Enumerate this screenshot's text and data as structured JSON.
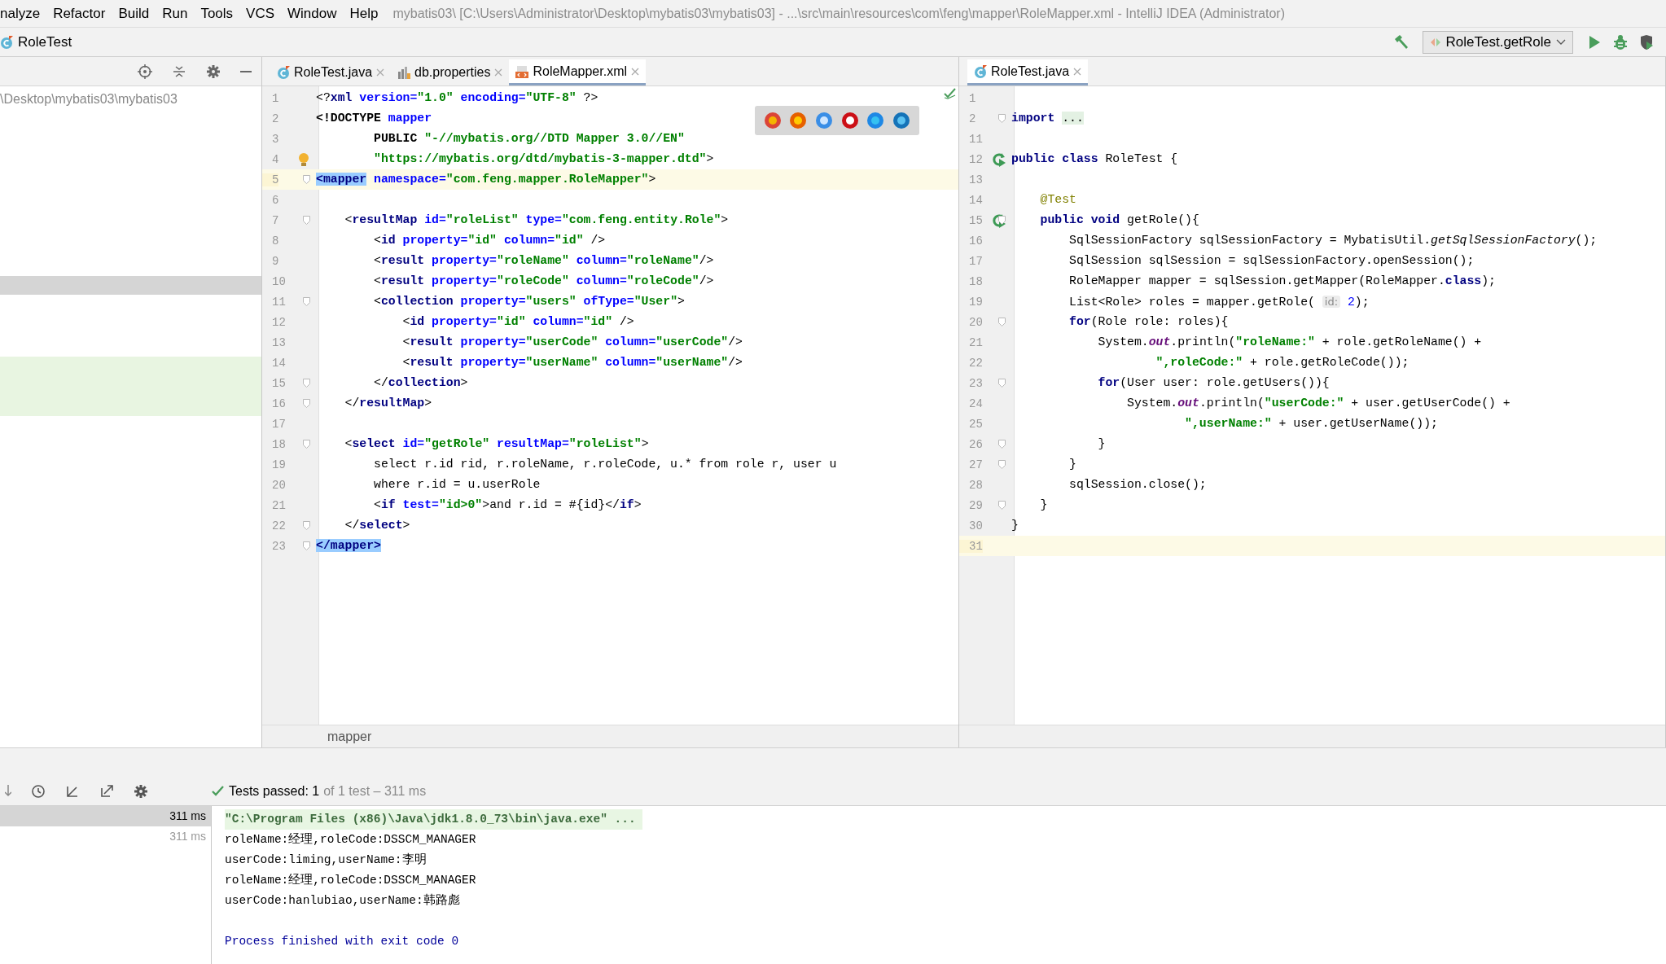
{
  "menu_bar": {
    "items": [
      "nalyze",
      "Refactor",
      "Build",
      "Run",
      "Tools",
      "VCS",
      "Window",
      "Help"
    ],
    "title": "mybatis03\\ [C:\\Users\\Administrator\\Desktop\\mybatis03\\mybatis03] - ...\\src\\main\\resources\\com\\feng\\mapper\\RoleMapper.xml - IntelliJ IDEA (Administrator)"
  },
  "nav_bar": {
    "breadcrumb": "RoleTest",
    "run_config": "RoleTest.getRole"
  },
  "project_panel": {
    "path": "\\Desktop\\mybatis03\\mybatis03",
    "tree_rows": [
      {
        "kind": "selected"
      },
      {
        "kind": "modified"
      }
    ]
  },
  "left_editor": {
    "tabs": [
      {
        "label": "RoleTest.java",
        "kind": "class",
        "selected": false
      },
      {
        "label": "db.properties",
        "kind": "properties",
        "selected": false
      },
      {
        "label": "RoleMapper.xml",
        "kind": "xml",
        "selected": true
      }
    ],
    "lines": [
      {
        "n": "1",
        "fold": false,
        "current": false,
        "tokens": [
          {
            "kind": "p",
            "text": "<?"
          },
          {
            "kind": "tag",
            "text": "xml"
          },
          {
            "kind": "attr",
            "text": " version="
          },
          {
            "kind": "val",
            "text": "\"1.0\""
          },
          {
            "kind": "attr",
            "text": " encoding="
          },
          {
            "kind": "val",
            "text": "\"UTF-8\""
          },
          {
            "kind": "p",
            "text": " ?>"
          }
        ]
      },
      {
        "n": "2",
        "fold": false,
        "current": false,
        "tokens": [
          {
            "kind": "dt",
            "text": "<!DOCTYPE"
          },
          {
            "kind": "attr",
            "text": " mapper"
          }
        ]
      },
      {
        "n": "3",
        "fold": false,
        "current": false,
        "tokens": [
          {
            "kind": "dt",
            "text": "        PUBLIC"
          },
          {
            "kind": "val",
            "text": " \"-//mybatis.org//DTD Mapper 3.0//EN\""
          }
        ]
      },
      {
        "n": "4",
        "fold": false,
        "current": false,
        "gutter": {
          "kind": "bulb"
        },
        "tokens": [
          {
            "kind": "val",
            "text": "        \"https://mybatis.org/dtd/mybatis-3-mapper.dtd\""
          },
          {
            "kind": "p",
            "text": ">"
          }
        ]
      },
      {
        "n": "5",
        "fold": true,
        "current": true,
        "tokens": [
          {
            "kind": "match",
            "text": "<mapper"
          },
          {
            "kind": "attr",
            "text": " namespace="
          },
          {
            "kind": "val",
            "text": "\"com.feng.mapper.RoleMapper\""
          },
          {
            "kind": "p",
            "text": ">"
          }
        ]
      },
      {
        "n": "6",
        "fold": false,
        "current": false
      },
      {
        "n": "7",
        "fold": true,
        "current": false,
        "tokens": [
          {
            "kind": "p",
            "text": "    <"
          },
          {
            "kind": "tag",
            "text": "resultMap"
          },
          {
            "kind": "attr",
            "text": " id="
          },
          {
            "kind": "val",
            "text": "\"roleList\""
          },
          {
            "kind": "attr",
            "text": " type="
          },
          {
            "kind": "val",
            "text": "\"com.feng.entity.Role\""
          },
          {
            "kind": "p",
            "text": ">"
          }
        ]
      },
      {
        "n": "8",
        "fold": false,
        "current": false,
        "tokens": [
          {
            "kind": "p",
            "text": "        <"
          },
          {
            "kind": "tag",
            "text": "id"
          },
          {
            "kind": "attr",
            "text": " property="
          },
          {
            "kind": "val",
            "text": "\"id\""
          },
          {
            "kind": "attr",
            "text": " column="
          },
          {
            "kind": "val",
            "text": "\"id\""
          },
          {
            "kind": "p",
            "text": " />"
          }
        ]
      },
      {
        "n": "9",
        "fold": false,
        "current": false,
        "tokens": [
          {
            "kind": "p",
            "text": "        <"
          },
          {
            "kind": "tag",
            "text": "result"
          },
          {
            "kind": "attr",
            "text": " property="
          },
          {
            "kind": "val",
            "text": "\"roleName\""
          },
          {
            "kind": "attr",
            "text": " column="
          },
          {
            "kind": "val",
            "text": "\"roleName\""
          },
          {
            "kind": "p",
            "text": "/>"
          }
        ]
      },
      {
        "n": "10",
        "fold": false,
        "current": false,
        "tokens": [
          {
            "kind": "p",
            "text": "        <"
          },
          {
            "kind": "tag",
            "text": "result"
          },
          {
            "kind": "attr",
            "text": " property="
          },
          {
            "kind": "val",
            "text": "\"roleCode\""
          },
          {
            "kind": "attr",
            "text": " column="
          },
          {
            "kind": "val",
            "text": "\"roleCode\""
          },
          {
            "kind": "p",
            "text": "/>"
          }
        ]
      },
      {
        "n": "11",
        "fold": true,
        "current": false,
        "tokens": [
          {
            "kind": "p",
            "text": "        <"
          },
          {
            "kind": "tag",
            "text": "collection"
          },
          {
            "kind": "attr",
            "text": " property="
          },
          {
            "kind": "val",
            "text": "\"users\""
          },
          {
            "kind": "attr",
            "text": " ofType="
          },
          {
            "kind": "val",
            "text": "\"User\""
          },
          {
            "kind": "p",
            "text": ">"
          }
        ]
      },
      {
        "n": "12",
        "fold": false,
        "current": false,
        "tokens": [
          {
            "kind": "p",
            "text": "            <"
          },
          {
            "kind": "tag",
            "text": "id"
          },
          {
            "kind": "attr",
            "text": " property="
          },
          {
            "kind": "val",
            "text": "\"id\""
          },
          {
            "kind": "attr",
            "text": " column="
          },
          {
            "kind": "val",
            "text": "\"id\""
          },
          {
            "kind": "p",
            "text": " />"
          }
        ]
      },
      {
        "n": "13",
        "fold": false,
        "current": false,
        "tokens": [
          {
            "kind": "p",
            "text": "            <"
          },
          {
            "kind": "tag",
            "text": "result"
          },
          {
            "kind": "attr",
            "text": " property="
          },
          {
            "kind": "val",
            "text": "\"userCode\""
          },
          {
            "kind": "attr",
            "text": " column="
          },
          {
            "kind": "val",
            "text": "\"userCode\""
          },
          {
            "kind": "p",
            "text": "/>"
          }
        ]
      },
      {
        "n": "14",
        "fold": false,
        "current": false,
        "tokens": [
          {
            "kind": "p",
            "text": "            <"
          },
          {
            "kind": "tag",
            "text": "result"
          },
          {
            "kind": "attr",
            "text": " property="
          },
          {
            "kind": "val",
            "text": "\"userName\""
          },
          {
            "kind": "attr",
            "text": " column="
          },
          {
            "kind": "val",
            "text": "\"userName\""
          },
          {
            "kind": "p",
            "text": "/>"
          }
        ]
      },
      {
        "n": "15",
        "fold": true,
        "current": false,
        "tokens": [
          {
            "kind": "p",
            "text": "        </"
          },
          {
            "kind": "tag",
            "text": "collection"
          },
          {
            "kind": "p",
            "text": ">"
          }
        ]
      },
      {
        "n": "16",
        "fold": true,
        "current": false,
        "tokens": [
          {
            "kind": "p",
            "text": "    </"
          },
          {
            "kind": "tag",
            "text": "resultMap"
          },
          {
            "kind": "p",
            "text": ">"
          }
        ]
      },
      {
        "n": "17",
        "fold": false,
        "current": false
      },
      {
        "n": "18",
        "fold": true,
        "current": false,
        "tokens": [
          {
            "kind": "p",
            "text": "    <"
          },
          {
            "kind": "tag",
            "text": "select"
          },
          {
            "kind": "attr",
            "text": " id="
          },
          {
            "kind": "val",
            "text": "\"getRole\""
          },
          {
            "kind": "attr",
            "text": " resultMap="
          },
          {
            "kind": "val",
            "text": "\"roleList\""
          },
          {
            "kind": "p",
            "text": ">"
          }
        ]
      },
      {
        "n": "19",
        "fold": false,
        "current": false,
        "tokens": [
          {
            "kind": "p",
            "text": "        select r.id rid, r.roleName, r.roleCode, u.* from role r, user u"
          }
        ]
      },
      {
        "n": "20",
        "fold": false,
        "current": false,
        "tokens": [
          {
            "kind": "p",
            "text": "        where r.id = u.userRole"
          }
        ]
      },
      {
        "n": "21",
        "fold": false,
        "current": false,
        "tokens": [
          {
            "kind": "p",
            "text": "        <"
          },
          {
            "kind": "tag",
            "text": "if"
          },
          {
            "kind": "attr",
            "text": " test="
          },
          {
            "kind": "val",
            "text": "\"id>0\""
          },
          {
            "kind": "p",
            "text": ">and r.id = #{id}</"
          },
          {
            "kind": "tag",
            "text": "if"
          },
          {
            "kind": "p",
            "text": ">"
          }
        ]
      },
      {
        "n": "22",
        "fold": true,
        "current": false,
        "tokens": [
          {
            "kind": "p",
            "text": "    </"
          },
          {
            "kind": "tag",
            "text": "select"
          },
          {
            "kind": "p",
            "text": ">"
          }
        ]
      },
      {
        "n": "23",
        "fold": true,
        "current": false,
        "tokens": [
          {
            "kind": "match",
            "text": "</mapper>"
          }
        ]
      }
    ],
    "breadcrumb": "mapper"
  },
  "right_editor": {
    "tabs": [
      {
        "label": "RoleTest.java",
        "kind": "class",
        "selected": true
      }
    ],
    "lines": [
      {
        "n": "1",
        "fold": false,
        "current": false
      },
      {
        "n": "2",
        "fold": true,
        "current": false,
        "tokens": [
          {
            "kind": "kw",
            "text": "import "
          },
          {
            "kind": "folded",
            "text": "..."
          }
        ]
      },
      {
        "n": "11",
        "fold": false,
        "current": false
      },
      {
        "n": "12",
        "fold": false,
        "current": false,
        "gutter": {
          "kind": "run"
        },
        "tokens": [
          {
            "kind": "kw",
            "text": "public class"
          },
          {
            "kind": "p",
            "text": " RoleTest {"
          }
        ]
      },
      {
        "n": "13",
        "fold": false,
        "current": false
      },
      {
        "n": "14",
        "fold": false,
        "current": false,
        "tokens": [
          {
            "kind": "anno",
            "text": "    @Test"
          }
        ]
      },
      {
        "n": "15",
        "fold": true,
        "current": false,
        "gutter": {
          "kind": "run"
        },
        "tokens": [
          {
            "kind": "kw",
            "text": "    public void"
          },
          {
            "kind": "p",
            "text": " getRole(){"
          }
        ]
      },
      {
        "n": "16",
        "fold": false,
        "current": false,
        "tokens": [
          {
            "kind": "p",
            "text": "        SqlSessionFactory sqlSessionFactory = MybatisUtil."
          },
          {
            "kind": "ital",
            "text": "getSqlSessionFactory"
          },
          {
            "kind": "p",
            "text": "();"
          }
        ]
      },
      {
        "n": "17",
        "fold": false,
        "current": false,
        "tokens": [
          {
            "kind": "p",
            "text": "        SqlSession sqlSession = sqlSessionFactory.openSession();"
          }
        ]
      },
      {
        "n": "18",
        "fold": false,
        "current": false,
        "tokens": [
          {
            "kind": "p",
            "text": "        RoleMapper mapper = sqlSession.getMapper(RoleMapper."
          },
          {
            "kind": "kw",
            "text": "class"
          },
          {
            "kind": "p",
            "text": ");"
          }
        ]
      },
      {
        "n": "19",
        "fold": false,
        "current": false,
        "tokens": [
          {
            "kind": "p",
            "text": "        List<Role> roles = mapper.getRole( "
          },
          {
            "kind": "hint",
            "text": "id:"
          },
          {
            "kind": "num",
            "text": " 2"
          },
          {
            "kind": "p",
            "text": ");"
          }
        ]
      },
      {
        "n": "20",
        "fold": true,
        "current": false,
        "tokens": [
          {
            "kind": "kw",
            "text": "        for"
          },
          {
            "kind": "p",
            "text": "(Role role: roles){"
          }
        ]
      },
      {
        "n": "21",
        "fold": false,
        "current": false,
        "tokens": [
          {
            "kind": "p",
            "text": "            System."
          },
          {
            "kind": "static",
            "text": "out"
          },
          {
            "kind": "p",
            "text": ".println("
          },
          {
            "kind": "str",
            "text": "\"roleName:\""
          },
          {
            "kind": "p",
            "text": " + role.getRoleName() +"
          }
        ]
      },
      {
        "n": "22",
        "fold": false,
        "current": false,
        "tokens": [
          {
            "kind": "str",
            "text": "                    \",roleCode:\""
          },
          {
            "kind": "p",
            "text": " + role.getRoleCode());"
          }
        ]
      },
      {
        "n": "23",
        "fold": true,
        "current": false,
        "tokens": [
          {
            "kind": "kw",
            "text": "            for"
          },
          {
            "kind": "p",
            "text": "(User user: role.getUsers()){"
          }
        ]
      },
      {
        "n": "24",
        "fold": false,
        "current": false,
        "tokens": [
          {
            "kind": "p",
            "text": "                System."
          },
          {
            "kind": "static",
            "text": "out"
          },
          {
            "kind": "p",
            "text": ".println("
          },
          {
            "kind": "str",
            "text": "\"userCode:\""
          },
          {
            "kind": "p",
            "text": " + user.getUserCode() +"
          }
        ]
      },
      {
        "n": "25",
        "fold": false,
        "current": false,
        "tokens": [
          {
            "kind": "str",
            "text": "                        \",userName:\""
          },
          {
            "kind": "p",
            "text": " + user.getUserName());"
          }
        ]
      },
      {
        "n": "26",
        "fold": true,
        "current": false,
        "tokens": [
          {
            "kind": "p",
            "text": "            }"
          }
        ]
      },
      {
        "n": "27",
        "fold": true,
        "current": false,
        "tokens": [
          {
            "kind": "p",
            "text": "        }"
          }
        ]
      },
      {
        "n": "28",
        "fold": false,
        "current": false,
        "tokens": [
          {
            "kind": "p",
            "text": "        sqlSession.close();"
          }
        ]
      },
      {
        "n": "29",
        "fold": true,
        "current": false,
        "tokens": [
          {
            "kind": "p",
            "text": "    }"
          }
        ]
      },
      {
        "n": "30",
        "fold": false,
        "current": false,
        "tokens": [
          {
            "kind": "p",
            "text": "}"
          }
        ]
      },
      {
        "n": "31",
        "fold": false,
        "current": true
      }
    ]
  },
  "run_panel": {
    "status": {
      "passed": "Tests passed: 1",
      "detail": "of 1 test – 311 ms"
    },
    "tests": [
      {
        "duration": "311 ms",
        "selected": true
      },
      {
        "duration": "311 ms",
        "selected": false
      }
    ],
    "output": [
      {
        "kind": "command",
        "text": "\"C:\\Program Files (x86)\\Java\\jdk1.8.0_73\\bin\\java.exe\" ..."
      },
      {
        "kind": "stdout",
        "text": "roleName:经理,roleCode:DSSCM_MANAGER"
      },
      {
        "kind": "stdout",
        "text": "userCode:liming,userName:李明"
      },
      {
        "kind": "stdout",
        "text": "roleName:经理,roleCode:DSSCM_MANAGER"
      },
      {
        "kind": "stdout",
        "text": "userCode:hanlubiao,userName:韩路彪"
      },
      {
        "kind": "exit",
        "text": "Process finished with exit code 0"
      }
    ]
  }
}
